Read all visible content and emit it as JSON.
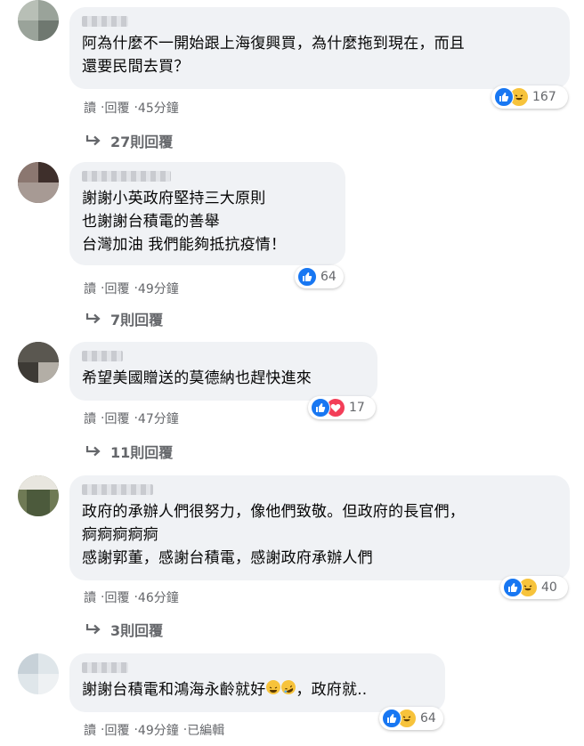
{
  "comments": [
    {
      "text": "阿為什麼不一開始跟上海復興買，為什麼拖到現在，而且\n還要民間去買？",
      "reaction_count": "167",
      "reactions": [
        "like-icon",
        "haha-icon"
      ],
      "actions": {
        "read": "讀",
        "reply": "回覆",
        "time": "45分鐘"
      },
      "replies": "27則回覆"
    },
    {
      "text": "謝謝小英政府堅持三大原則\n也謝謝台積電的善舉\n台灣加油 我們能夠抵抗疫情！",
      "reaction_count": "64",
      "reactions": [
        "like-icon"
      ],
      "actions": {
        "read": "讀",
        "reply": "回覆",
        "time": "49分鐘"
      },
      "replies": "7則回覆"
    },
    {
      "text": "希望美國贈送的莫德納也趕快進來",
      "reaction_count": "17",
      "reactions": [
        "like-icon",
        "love-icon"
      ],
      "actions": {
        "read": "讀",
        "reply": "回覆",
        "time": "47分鐘"
      },
      "replies": "11則回覆"
    },
    {
      "text": "政府的承辦人們很努力，像他們致敬。但政府的長官們，\n痾痾痾痾痾\n感謝郭董，感謝台積電，感謝政府承辦人們",
      "reaction_count": "40",
      "reactions": [
        "like-icon",
        "haha-icon"
      ],
      "actions": {
        "read": "讀",
        "reply": "回覆",
        "time": "46分鐘"
      },
      "replies": "3則回覆"
    },
    {
      "text_before": "謝謝台積電和鴻海永齡就好",
      "text_after": "，政府就..",
      "reaction_count": "64",
      "reactions": [
        "like-icon",
        "haha-icon"
      ],
      "actions": {
        "read": "讀",
        "reply": "回覆",
        "time": "49分鐘",
        "edited": "已編輯"
      }
    }
  ],
  "colors": {
    "bubble": "#f0f2f5",
    "like": "#1877f2",
    "haha": "#f7c33b",
    "love": "#f33e58",
    "meta": "#65676b"
  }
}
